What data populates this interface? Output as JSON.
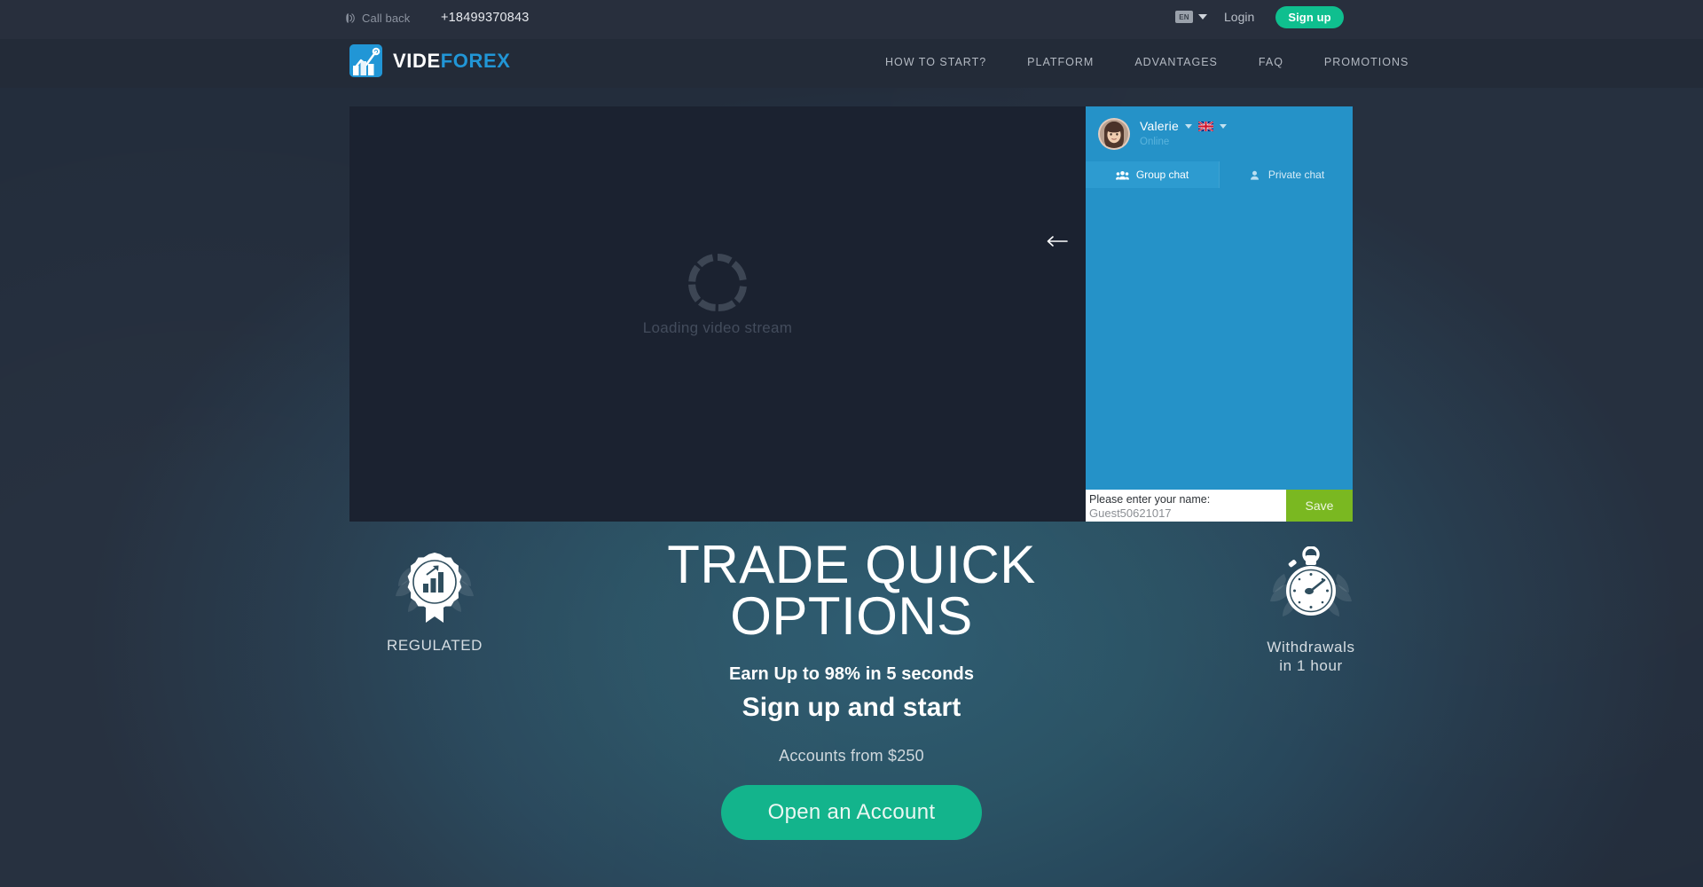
{
  "topbar": {
    "callback_label": "Call back",
    "callback_icon": "phone-callback-icon",
    "phone": "+18499370843",
    "language_code": "EN",
    "login_label": "Login",
    "signup_label": "Sign up"
  },
  "brand": {
    "name_part1": "VIDE",
    "name_part2": "FOREX",
    "logo_icon": "chart-logo-icon",
    "accent_color": "#2196d6"
  },
  "nav": {
    "items": [
      {
        "label": "HOW TO START?"
      },
      {
        "label": "PLATFORM"
      },
      {
        "label": "ADVANTAGES"
      },
      {
        "label": "FAQ"
      },
      {
        "label": "PROMOTIONS"
      }
    ]
  },
  "video": {
    "loading_text": "Loading video stream",
    "spinner_icon": "loading-spinner-icon",
    "collapse_icon": "arrow-left-icon"
  },
  "chat": {
    "agent_name": "Valerie",
    "agent_status": "Online",
    "avatar_icon": "agent-avatar",
    "flag_icon": "uk-flag-icon",
    "tabs": [
      {
        "label": "Group chat",
        "icon": "group-chat-icon",
        "active": true
      },
      {
        "label": "Private chat",
        "icon": "private-chat-icon",
        "active": false
      }
    ],
    "name_prompt": "Please enter your name:",
    "name_value": "Guest50621017",
    "name_placeholder": "Guest50621017",
    "save_label": "Save",
    "header_color": "#2592c8",
    "save_color": "#7ab821"
  },
  "hero": {
    "badge_left": {
      "icon": "regulated-award-icon",
      "caption": "REGULATED"
    },
    "badge_right": {
      "icon": "stopwatch-icon",
      "caption_line1": "Withdrawals",
      "caption_line2": "in 1 hour"
    },
    "title_line1": "TRADE QUICK",
    "title_line2": "OPTIONS",
    "subtitle": "Earn Up to 98% in 5 seconds",
    "subtitle_strong": "Sign up and start",
    "note": "Accounts from $250",
    "cta_label": "Open an Account",
    "cta_color": "#13b48c"
  }
}
